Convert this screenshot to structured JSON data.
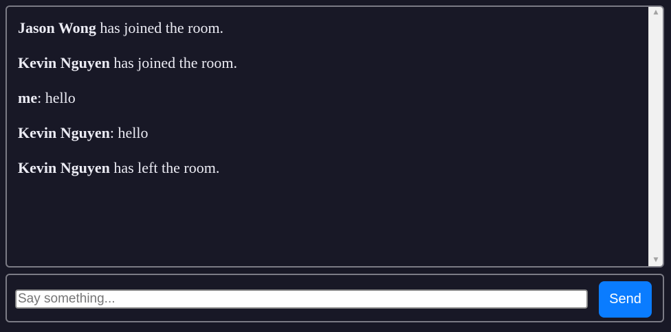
{
  "messages": [
    {
      "sender": "Jason Wong",
      "text": " has joined the room."
    },
    {
      "sender": "Kevin Nguyen",
      "text": " has joined the room."
    },
    {
      "sender": "me",
      "text": ": hello"
    },
    {
      "sender": "Kevin Nguyen",
      "text": ": hello"
    },
    {
      "sender": "Kevin Nguyen",
      "text": " has left the room."
    }
  ],
  "scrollbar": {
    "up_icon": "triangle-up-icon",
    "down_icon": "triangle-down-icon",
    "up_glyph": "▲",
    "down_glyph": "▼"
  },
  "composer": {
    "placeholder": "Say something...",
    "value": "",
    "send_label": "Send"
  },
  "colors": {
    "background": "#181826",
    "border": "#7c7c86",
    "message_text": "#ececf4",
    "send_button": "#0a7cff"
  }
}
